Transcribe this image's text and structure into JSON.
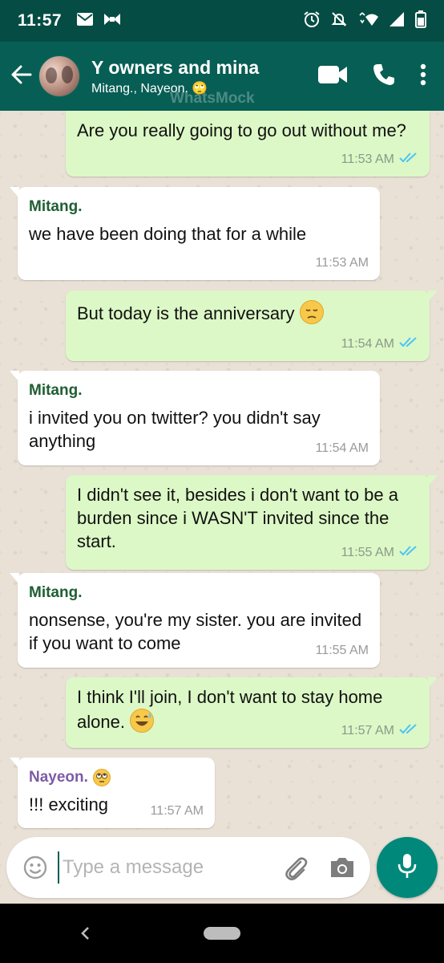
{
  "status_bar": {
    "time": "11:57",
    "left_icons": [
      "mail-icon",
      "bow-icon"
    ],
    "right_icons": [
      "alarm-icon",
      "mute-icon",
      "wifi-icon",
      "signal-icon",
      "battery-icon"
    ],
    "background": "#054d44"
  },
  "header": {
    "title": "Y owners and mina",
    "subtitle": "Mitang., Nayeon. 🙄",
    "watermark": "WhatsMock",
    "icons": [
      "back-arrow-icon",
      "video-call-icon",
      "phone-call-icon",
      "more-options-icon"
    ],
    "background": "#075e54"
  },
  "messages": [
    {
      "direction": "out",
      "text": "Are you really going to go out without me?",
      "time": "11:53 AM",
      "ticks": "double-blue"
    },
    {
      "direction": "in",
      "sender": "Mitang.",
      "sender_color": "#1f5e33",
      "text": "we have been doing that for a while",
      "time": "11:53 AM"
    },
    {
      "direction": "out",
      "text": "But today is the anniversary",
      "emoji": "pensive-face",
      "time": "11:54 AM",
      "ticks": "double-blue"
    },
    {
      "direction": "in",
      "sender": "Mitang.",
      "sender_color": "#1f5e33",
      "text": "i invited you on twitter? you didn't say anything",
      "time": "11:54 AM"
    },
    {
      "direction": "out",
      "text": "I didn't see it, besides i don't want to be a burden since i WASN'T invited since the start.",
      "time": "11:55 AM",
      "ticks": "double-blue"
    },
    {
      "direction": "in",
      "sender": "Mitang.",
      "sender_color": "#1f5e33",
      "text": "nonsense, you're my sister. you are invited if you want to come",
      "time": "11:55 AM"
    },
    {
      "direction": "out",
      "text": "I think I'll join, I don't want to stay home alone.",
      "emoji": "grinning-sweat-face",
      "time": "11:57 AM",
      "ticks": "double-blue"
    },
    {
      "direction": "in",
      "sender": "Nayeon.",
      "sender_emoji": "eye-roll-face",
      "sender_color": "#7d5ba6",
      "text": "!!! exciting",
      "time": "11:57 AM"
    }
  ],
  "colors": {
    "outgoing_bubble": "#dcf8c6",
    "incoming_bubble": "#ffffff",
    "read_ticks": "#4fc3f7",
    "chat_background": "#e9e1d6",
    "mic_button": "#00897b"
  },
  "composer": {
    "placeholder": "Type a message",
    "value": "",
    "icons": [
      "emoji-icon",
      "attach-icon",
      "camera-icon",
      "mic-icon"
    ]
  },
  "nav_bar": {
    "icons": [
      "nav-back-icon",
      "nav-home-pill"
    ]
  }
}
